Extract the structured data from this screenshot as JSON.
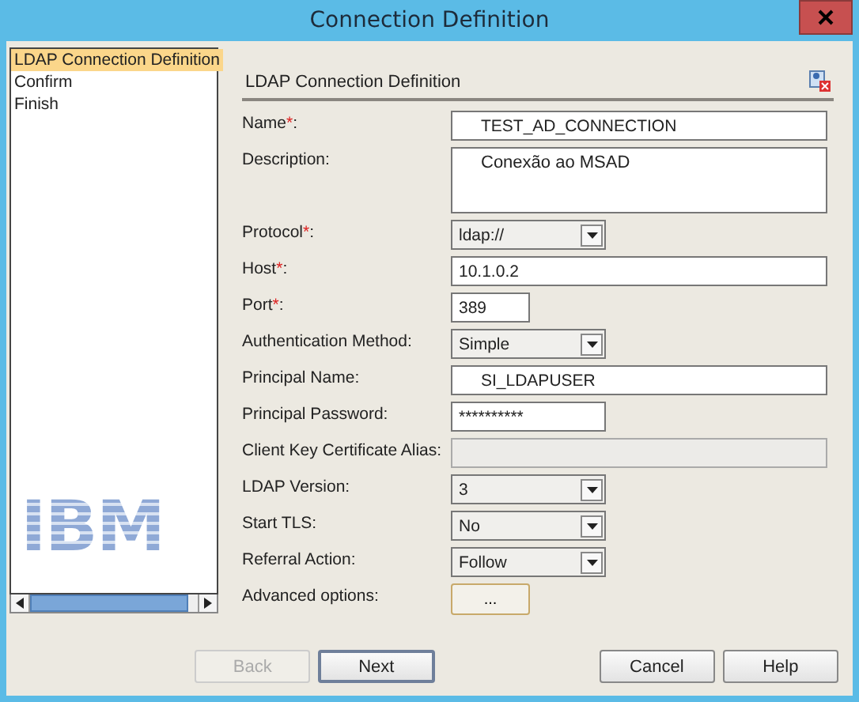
{
  "window": {
    "title": "Connection Definition"
  },
  "steps": [
    {
      "label": "LDAP Connection Definition",
      "selected": true
    },
    {
      "label": "Confirm",
      "selected": false
    },
    {
      "label": "Finish",
      "selected": false
    }
  ],
  "logo": "IBM",
  "section": {
    "title": "LDAP Connection Definition"
  },
  "fields": [
    {
      "label": "Name",
      "asterisk": "*",
      "colon": ":",
      "kind": "text",
      "value": "TEST_AD_CONNECTION",
      "disabled": false
    },
    {
      "label": "Description:",
      "kind": "textarea",
      "value": "Conexão ao MSAD",
      "disabled": false
    },
    {
      "label": "Protocol",
      "asterisk": "*",
      "colon": ":",
      "kind": "select",
      "value": "ldap://",
      "disabled": false
    },
    {
      "label": "Host",
      "asterisk": "*",
      "colon": ":",
      "kind": "text",
      "value": "10.1.0.2",
      "disabled": false
    },
    {
      "label": "Port",
      "asterisk": "*",
      "colon": ":",
      "kind": "text",
      "value": "389",
      "disabled": false
    },
    {
      "label": "Authentication Method:",
      "kind": "select",
      "value": "Simple",
      "disabled": false
    },
    {
      "label": "Principal Name:",
      "kind": "text",
      "value": "SI_LDAPUSER",
      "disabled": false
    },
    {
      "label": "Principal Password:",
      "kind": "text",
      "value": "**********",
      "disabled": false
    },
    {
      "label": "Client Key Certificate Alias:",
      "kind": "text",
      "disabled": true
    },
    {
      "label": "LDAP Version:",
      "kind": "select",
      "value": "3",
      "disabled": false
    },
    {
      "label": "Start TLS:",
      "kind": "select",
      "value": "No",
      "disabled": false
    },
    {
      "label": "Referral Action:",
      "kind": "select",
      "value": "Follow",
      "disabled": false
    },
    {
      "label": "Advanced options:",
      "kind": "button",
      "value": "...",
      "disabled": false
    }
  ],
  "buttons": [
    {
      "label": "Back",
      "disabled": true,
      "default": false
    },
    {
      "label": "Next",
      "disabled": false,
      "default": true
    },
    {
      "label": "Cancel",
      "disabled": false,
      "default": false
    },
    {
      "label": "Help",
      "disabled": false,
      "default": false
    }
  ]
}
